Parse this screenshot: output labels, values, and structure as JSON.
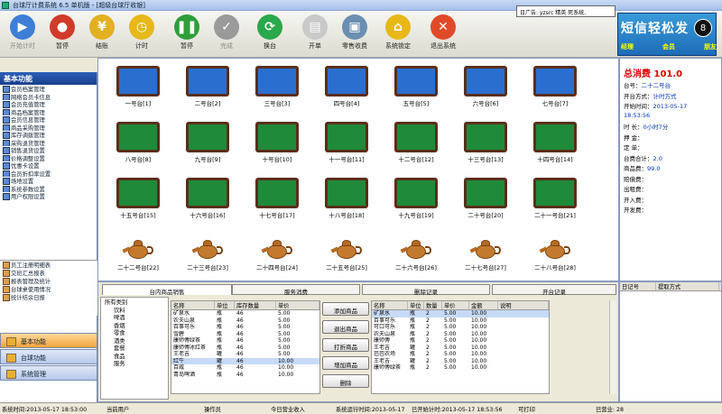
{
  "window": {
    "title": "台球厅计费系统 6.5 单机版 - [超级台球厅收银]"
  },
  "toolbar": {
    "buttons": [
      {
        "label": "开始计时",
        "color": "#3d7ed6",
        "icon": "play-icon"
      },
      {
        "label": "暂停",
        "color": "#d23a2a",
        "icon": "record-icon"
      },
      {
        "label": "结账",
        "color": "#e2b020",
        "icon": "coins-icon"
      },
      {
        "label": "计时",
        "color": "#e6b81a",
        "icon": "clock-icon"
      },
      {
        "label": "暂停",
        "color": "#2f9e3a",
        "icon": "pause-icon"
      },
      {
        "label": "完成",
        "color": "#9a9a9a",
        "icon": "check-icon"
      },
      {
        "label": "换台",
        "color": "#2aa84a",
        "icon": "refresh-icon"
      },
      {
        "label": "开单",
        "color": "#c9c9c9",
        "icon": "bag-icon"
      },
      {
        "label": "零售收费",
        "color": "#6b8fb0",
        "icon": "pos-icon"
      },
      {
        "label": "系统锁定",
        "color": "#e8b818",
        "icon": "lock-icon"
      },
      {
        "label": "退出系统",
        "color": "#e04a2a",
        "icon": "close-icon"
      }
    ]
  },
  "notice": "日广告: yzsrc 精英 死系统.",
  "brand": {
    "title": "短信轻松发",
    "tags": [
      "经理",
      "会员",
      "朋友"
    ],
    "ball": "8"
  },
  "sidebar": {
    "title": "基本功能",
    "items": [
      "会员档案管理",
      "网络会员卡信息",
      "会员充值管理",
      "商品档案管理",
      "会员信息管理",
      "商品采购管理",
      "库存调拨管理",
      "采购退货管理",
      "销售退货设置",
      "价格调整设置",
      "优惠卡设置",
      "会员折扣率设置",
      "场地设置",
      "系统参数设置",
      "用户权限设置"
    ],
    "sub_items": [
      "员工注册明细表",
      "交班汇总报表",
      "报表管理及统计",
      "台球桌使用情况",
      "统计结余日报"
    ],
    "nav": [
      "基本功能",
      "台球功能",
      "系统管理"
    ]
  },
  "tables": [
    {
      "label": "一号台[1]",
      "kind": "blue"
    },
    {
      "label": "二号台[2]",
      "kind": "blue"
    },
    {
      "label": "三号台[3]",
      "kind": "blue"
    },
    {
      "label": "四号台[4]",
      "kind": "blue"
    },
    {
      "label": "五号台[5]",
      "kind": "blue"
    },
    {
      "label": "六号台[6]",
      "kind": "blue"
    },
    {
      "label": "七号台[7]",
      "kind": "blue"
    },
    {
      "label": "八号台[8]",
      "kind": "green"
    },
    {
      "label": "九号台[9]",
      "kind": "green"
    },
    {
      "label": "十号台[10]",
      "kind": "green"
    },
    {
      "label": "十一号台[11]",
      "kind": "green"
    },
    {
      "label": "十二号台[12]",
      "kind": "green"
    },
    {
      "label": "十三号台[13]",
      "kind": "green"
    },
    {
      "label": "十四号台[14]",
      "kind": "green"
    },
    {
      "label": "十五号台[15]",
      "kind": "green"
    },
    {
      "label": "十六号台[16]",
      "kind": "green"
    },
    {
      "label": "十七号台[17]",
      "kind": "green"
    },
    {
      "label": "十八号台[18]",
      "kind": "green"
    },
    {
      "label": "十九号台[19]",
      "kind": "green"
    },
    {
      "label": "二十号台[20]",
      "kind": "green"
    },
    {
      "label": "二十一号台[21]",
      "kind": "green"
    },
    {
      "label": "二十二号台[22]",
      "kind": "tea"
    },
    {
      "label": "二十三号台[23]",
      "kind": "tea"
    },
    {
      "label": "二十四号台[24]",
      "kind": "tea"
    },
    {
      "label": "二十五号台[25]",
      "kind": "tea"
    },
    {
      "label": "二十六号台[26]",
      "kind": "tea"
    },
    {
      "label": "二十七号台[27]",
      "kind": "tea"
    },
    {
      "label": "二十八号台[28]",
      "kind": "tea"
    }
  ],
  "info": {
    "total": "总消费 101.0",
    "rows": [
      {
        "k": "台号：",
        "v": "二十二号台"
      },
      {
        "k": "开台方式：",
        "v": "计时方式"
      },
      {
        "k": "开始时间：",
        "v": "2013-05-17"
      },
      {
        "k": "",
        "v": "18:53:56"
      },
      {
        "k": "时 长：",
        "v": "0小时7分"
      },
      {
        "k": "押 金：",
        "v": ""
      },
      {
        "k": "定 单：",
        "v": ""
      },
      {
        "k": "台费合计：",
        "v": "2.0"
      },
      {
        "k": "商品费：",
        "v": "99.0"
      },
      {
        "k": "赔偿费：",
        "v": ""
      },
      {
        "k": "出租费：",
        "v": ""
      },
      {
        "k": "开入费：",
        "v": ""
      },
      {
        "k": "开发费：",
        "v": ""
      }
    ]
  },
  "bottom": {
    "tabs": [
      "台内商品销售",
      "服务消费",
      "删除记录",
      "开台记录"
    ],
    "tree": [
      "所有类别",
      "饮料",
      "啤酒",
      "香烟",
      "零食",
      "酒类",
      "套餐",
      "食品",
      "服务"
    ],
    "goods_header": [
      "名称",
      "单位",
      "库存数量",
      "单价"
    ],
    "goods": [
      [
        "矿泉水",
        "瓶",
        "46",
        "5.00"
      ],
      [
        "农夫山泉",
        "瓶",
        "46",
        "5.00"
      ],
      [
        "百事可乐",
        "瓶",
        "46",
        "5.00"
      ],
      [
        "雪碧",
        "瓶",
        "46",
        "5.00"
      ],
      [
        "康师傅绿茶",
        "瓶",
        "46",
        "5.00"
      ],
      [
        "康师傅冰红茶",
        "瓶",
        "46",
        "5.00"
      ],
      [
        "王老吉",
        "罐",
        "46",
        "5.00"
      ],
      [
        "红牛",
        "罐",
        "46",
        "10.00"
      ],
      [
        "百威",
        "瓶",
        "46",
        "10.00"
      ],
      [
        "青岛啤酒",
        "瓶",
        "46",
        "10.00"
      ]
    ],
    "mid_buttons": [
      "添加商品",
      "退出商品",
      "打折商品",
      "增加商品",
      "删除"
    ],
    "order_header": [
      "名称",
      "单位",
      "数量",
      "单价",
      "金额",
      "说明"
    ],
    "order": [
      [
        "矿泉水",
        "瓶",
        "2",
        "5.00",
        "10.00",
        ""
      ],
      [
        "百事可乐",
        "瓶",
        "2",
        "5.00",
        "10.00",
        ""
      ],
      [
        "可口可乐",
        "瓶",
        "2",
        "5.00",
        "10.00",
        ""
      ],
      [
        "农夫山泉",
        "瓶",
        "2",
        "5.00",
        "10.00",
        ""
      ],
      [
        "康师傅",
        "瓶",
        "2",
        "5.00",
        "10.00",
        ""
      ],
      [
        "王老吉",
        "罐",
        "2",
        "5.00",
        "10.00",
        ""
      ],
      [
        "芭芭农场",
        "瓶",
        "2",
        "5.00",
        "10.00",
        ""
      ],
      [
        "王老吉",
        "罐",
        "2",
        "5.00",
        "10.00",
        ""
      ],
      [
        "康师傅绿茶",
        "瓶",
        "2",
        "5.00",
        "10.00",
        ""
      ]
    ],
    "pay_header": [
      "日记号",
      "提取方式"
    ]
  },
  "status": [
    "系统时间:2013-05-17 18:53:00",
    "当前用户",
    "操作员",
    "今日营业收入",
    "系统运行时间:2013-05-17",
    "已开始计时:2013-05-17 18:53:56",
    "可打印",
    "已营业: 28"
  ]
}
